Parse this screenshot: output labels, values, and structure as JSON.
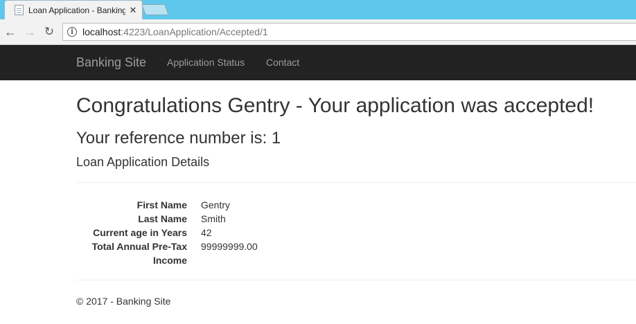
{
  "browser": {
    "tab_title": "Loan Application - Banking Site",
    "tab_close": "✕",
    "url_host": "localhost",
    "url_rest": ":4223/LoanApplication/Accepted/1"
  },
  "navbar": {
    "brand": "Banking Site",
    "links": [
      "Application Status",
      "Contact"
    ]
  },
  "page": {
    "heading": "Congratulations Gentry - Your application was accepted!",
    "reference": "Your reference number is: 1",
    "section_title": "Loan Application Details",
    "details": [
      {
        "label": "First Name",
        "value": "Gentry"
      },
      {
        "label": "Last Name",
        "value": "Smith"
      },
      {
        "label": "Current age in Years",
        "value": "42"
      },
      {
        "label": "Total Annual Pre-Tax Income",
        "value": "99999999.00"
      }
    ],
    "footer": "© 2017 - Banking Site"
  }
}
